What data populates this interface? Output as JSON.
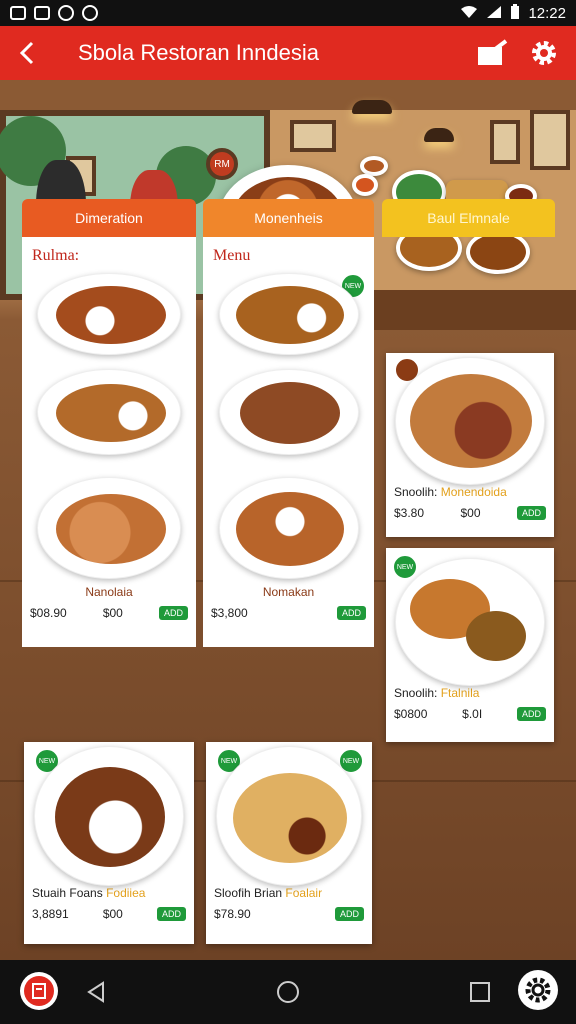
{
  "status_bar": {
    "time": "12:22"
  },
  "app_bar": {
    "title": "Sbola Restoran Inndesia"
  },
  "scene": {
    "sign_text": "RM"
  },
  "columns": [
    {
      "header": "Dimeration",
      "section_title": "Rulma:",
      "summary": {
        "name": "Nanolaia",
        "price": "$08.90",
        "sub": "$00",
        "button": "ADD"
      },
      "card": {
        "name_a": "Stuaih Foans",
        "name_b": "Fodiiea",
        "price": "3,8891",
        "sub": "$00",
        "button": "ADD"
      }
    },
    {
      "header": "Monenheis",
      "section_title": "Menu",
      "summary": {
        "name": "Nomakan",
        "price": "$3,800",
        "button": "ADD"
      },
      "card": {
        "name_a": "Sloofih Brian",
        "name_b": "Foalair",
        "price": "$78.90",
        "button": "ADD"
      }
    },
    {
      "header": "Baul Elmnale",
      "card1": {
        "name_a": "Snoolih:",
        "name_b": "Monendoida",
        "price": "$3.80",
        "sub": "$00",
        "button": "ADD"
      },
      "card2": {
        "name_a": "Snoolih:",
        "name_b": "Ftalnila",
        "price": "$0800",
        "sub": "$.0I",
        "button": "ADD"
      }
    }
  ],
  "badge_label": "NEW",
  "colors": {
    "primary": "#e02a20",
    "add_green": "#1f9a3a",
    "col1": "#e85b22",
    "col2": "#f0862b",
    "col3": "#f3c21f"
  }
}
